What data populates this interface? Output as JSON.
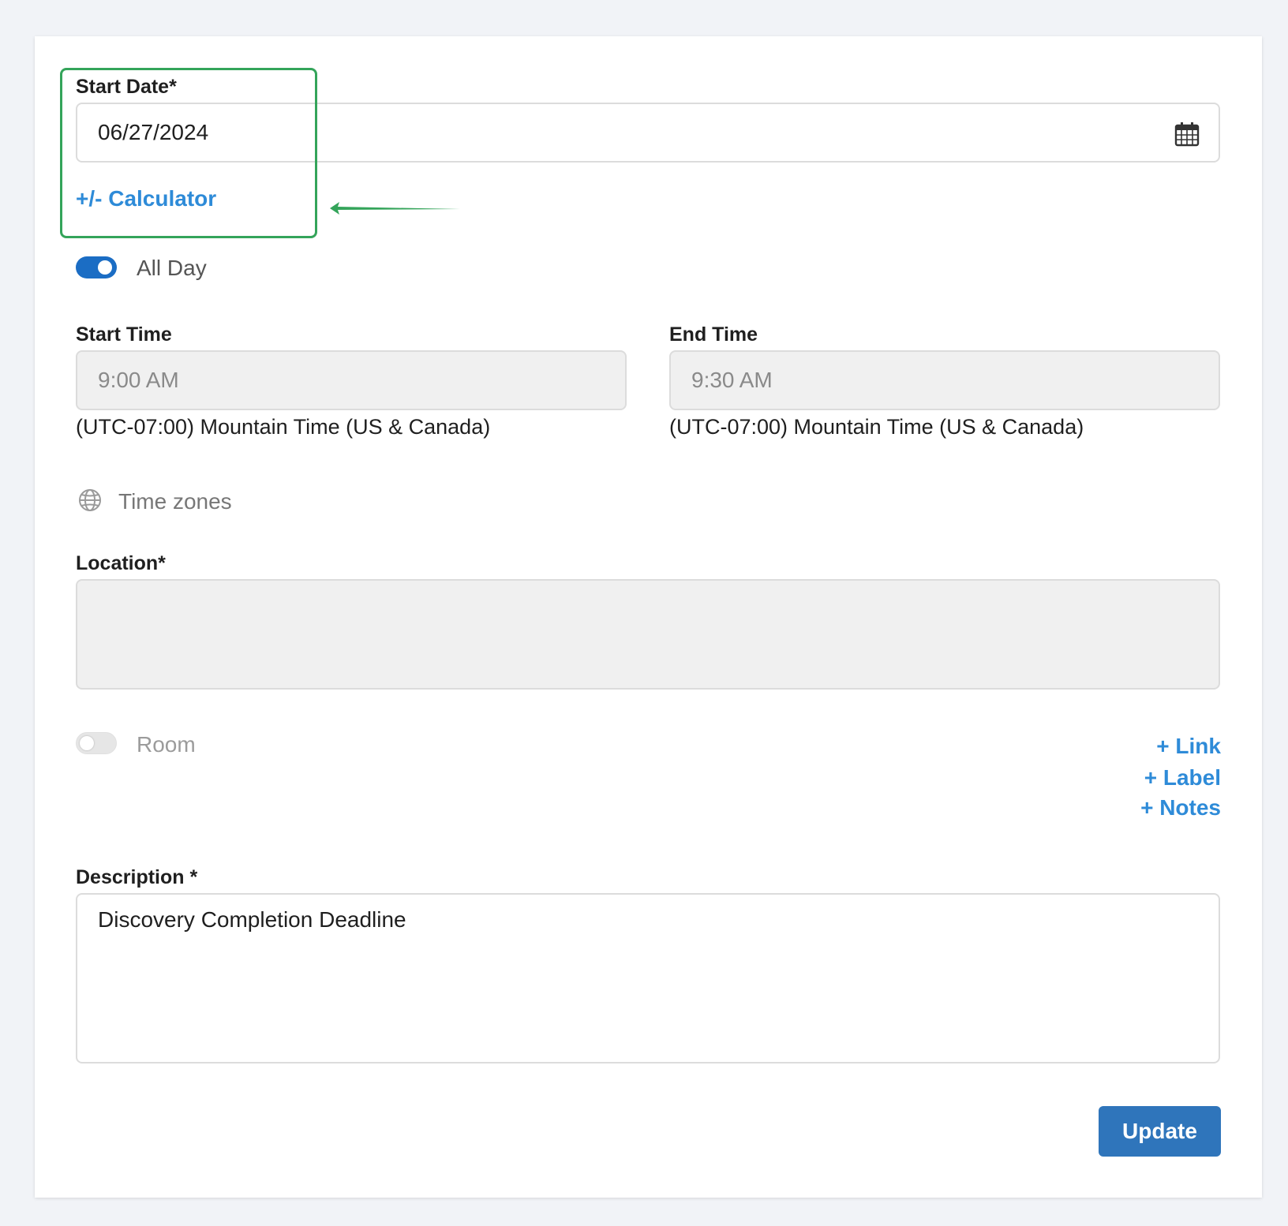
{
  "start_date": {
    "label": "Start Date*",
    "value": "06/27/2024",
    "calendar_icon": "calendar-icon",
    "calculator_link": "+/- Calculator"
  },
  "all_day": {
    "label": "All Day",
    "enabled": true
  },
  "start_time": {
    "label": "Start Time",
    "value": "9:00 AM",
    "timezone": "(UTC-07:00) Mountain Time (US & Canada)"
  },
  "end_time": {
    "label": "End Time",
    "value": "9:30 AM",
    "timezone": "(UTC-07:00) Mountain Time (US & Canada)"
  },
  "time_zones": {
    "label": "Time zones",
    "icon": "globe-icon"
  },
  "location": {
    "label": "Location*",
    "value": ""
  },
  "room": {
    "label": "Room",
    "enabled": false
  },
  "extras": {
    "link": "+ Link",
    "label": "+ Label",
    "notes": "+ Notes"
  },
  "description": {
    "label": "Description *",
    "value": "Discovery Completion Deadline"
  },
  "update_button": "Update",
  "colors": {
    "accent": "#2e8bd8",
    "toggle_on": "#1b6dc4",
    "button": "#2f75bb",
    "annotation": "#34a45a"
  }
}
